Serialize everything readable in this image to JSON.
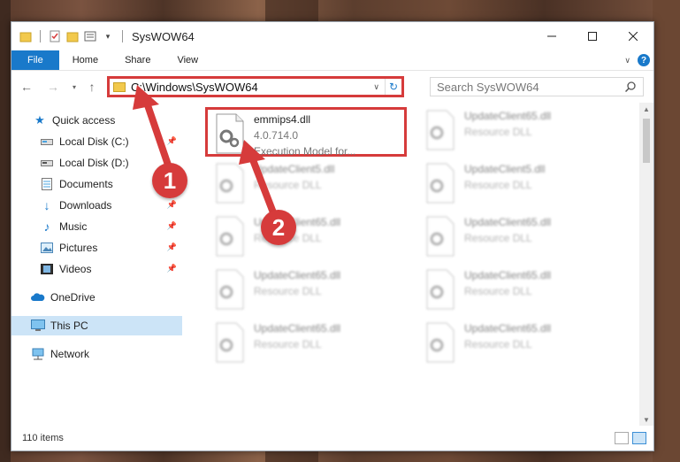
{
  "window": {
    "title": "SysWOW64",
    "ribbon_tabs": [
      "File",
      "Home",
      "Share",
      "View"
    ]
  },
  "address": {
    "path": "C:\\Windows\\SysWOW64",
    "search_placeholder": "Search SysWOW64"
  },
  "sidebar": {
    "quick_access": "Quick access",
    "items": [
      {
        "label": "Local Disk (C:)",
        "icon": "drive-icon",
        "pinned": true
      },
      {
        "label": "Local Disk (D:)",
        "icon": "drive-icon",
        "pinned": false
      },
      {
        "label": "Documents",
        "icon": "documents-icon",
        "pinned": true
      },
      {
        "label": "Downloads",
        "icon": "download-icon",
        "pinned": true
      },
      {
        "label": "Music",
        "icon": "music-icon",
        "pinned": true
      },
      {
        "label": "Pictures",
        "icon": "pictures-icon",
        "pinned": true
      },
      {
        "label": "Videos",
        "icon": "videos-icon",
        "pinned": true
      }
    ],
    "onedrive": "OneDrive",
    "this_pc": "This PC",
    "network": "Network"
  },
  "files": {
    "highlighted": {
      "name": "emmips4.dll",
      "version": "4.0.714.0",
      "description": "Execution Model for..."
    },
    "blurred_left": [
      {
        "name": "UpdateClient5.dll",
        "type": "Resource DLL"
      },
      {
        "name": "UpdateClient65.dll",
        "type": "Resource DLL"
      },
      {
        "name": "UpdateClient65.dll",
        "type": "Resource DLL"
      },
      {
        "name": "UpdateClient65.dll",
        "type": "Resource DLL"
      }
    ],
    "blurred_right": [
      {
        "name": "UpdateClient65.dll",
        "type": "Resource DLL"
      },
      {
        "name": "UpdateClient5.dll",
        "type": "Resource DLL"
      },
      {
        "name": "UpdateClient65.dll",
        "type": "Resource DLL"
      },
      {
        "name": "UpdateClient65.dll",
        "type": "Resource DLL"
      },
      {
        "name": "UpdateClient65.dll",
        "type": "Resource DLL"
      }
    ]
  },
  "status": {
    "item_count": "110 items"
  },
  "callouts": {
    "one": "1",
    "two": "2"
  },
  "colors": {
    "accent": "#1979ca",
    "highlight": "#d63b3b",
    "selected": "#cce4f7"
  }
}
